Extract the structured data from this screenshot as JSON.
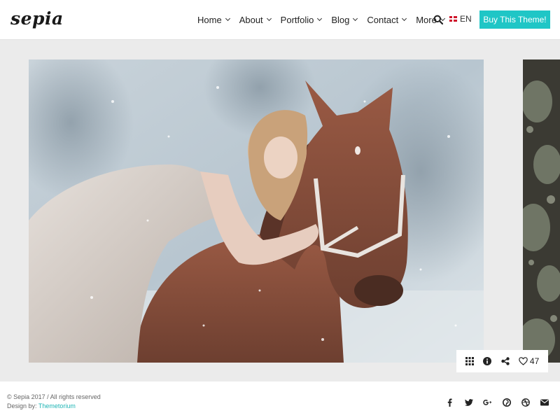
{
  "header": {
    "logo": "sepia",
    "nav": [
      {
        "label": "Home"
      },
      {
        "label": "About"
      },
      {
        "label": "Portfolio"
      },
      {
        "label": "Blog"
      },
      {
        "label": "Contact"
      },
      {
        "label": "More"
      }
    ],
    "language": "EN",
    "buy_button": "Buy This Theme!"
  },
  "gallery": {
    "likes": "47"
  },
  "footer": {
    "copyright": "© Sepia 2017 / All rights reserved",
    "design_prefix": "Design by: ",
    "design_link": "Themetorium"
  },
  "icons": {
    "search": "search-icon",
    "grid": "grid-icon",
    "info": "info-icon",
    "share": "share-icon",
    "like": "heart-icon",
    "social": [
      "facebook-icon",
      "twitter-icon",
      "google-plus-icon",
      "pinterest-icon",
      "dribbble-icon",
      "email-icon"
    ]
  },
  "colors": {
    "accent": "#1fc6c6",
    "background": "#ebebeb",
    "header": "#ffffff"
  }
}
